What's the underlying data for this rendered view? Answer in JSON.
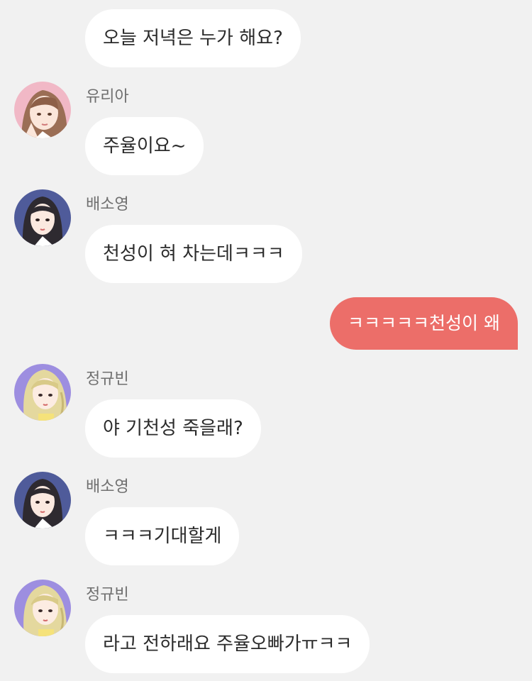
{
  "colors": {
    "background": "#f1f1f1",
    "bubble_other": "#ffffff",
    "bubble_mine": "#ec6e69",
    "sender_name": "#6f6f6f"
  },
  "messages": [
    {
      "text": "오늘 저녁은 누가 해요?"
    },
    {
      "sender": "유리아",
      "avatar": "avatar-yuria",
      "text": "주율이요~"
    },
    {
      "sender": "배소영",
      "avatar": "avatar-soyoung",
      "text": "천성이 혀 차는데ㅋㅋㅋ"
    },
    {
      "mine": true,
      "text": "ㅋㅋㅋㅋㅋ천성이 왜"
    },
    {
      "sender": "정규빈",
      "avatar": "avatar-gyubin",
      "text": "야 기천성 죽을래?"
    },
    {
      "sender": "배소영",
      "avatar": "avatar-soyoung",
      "text": "ㅋㅋㅋ기대할게"
    },
    {
      "sender": "정규빈",
      "avatar": "avatar-gyubin",
      "text": "라고 전하래요 주율오빠가ㅠㅋㅋ"
    }
  ]
}
